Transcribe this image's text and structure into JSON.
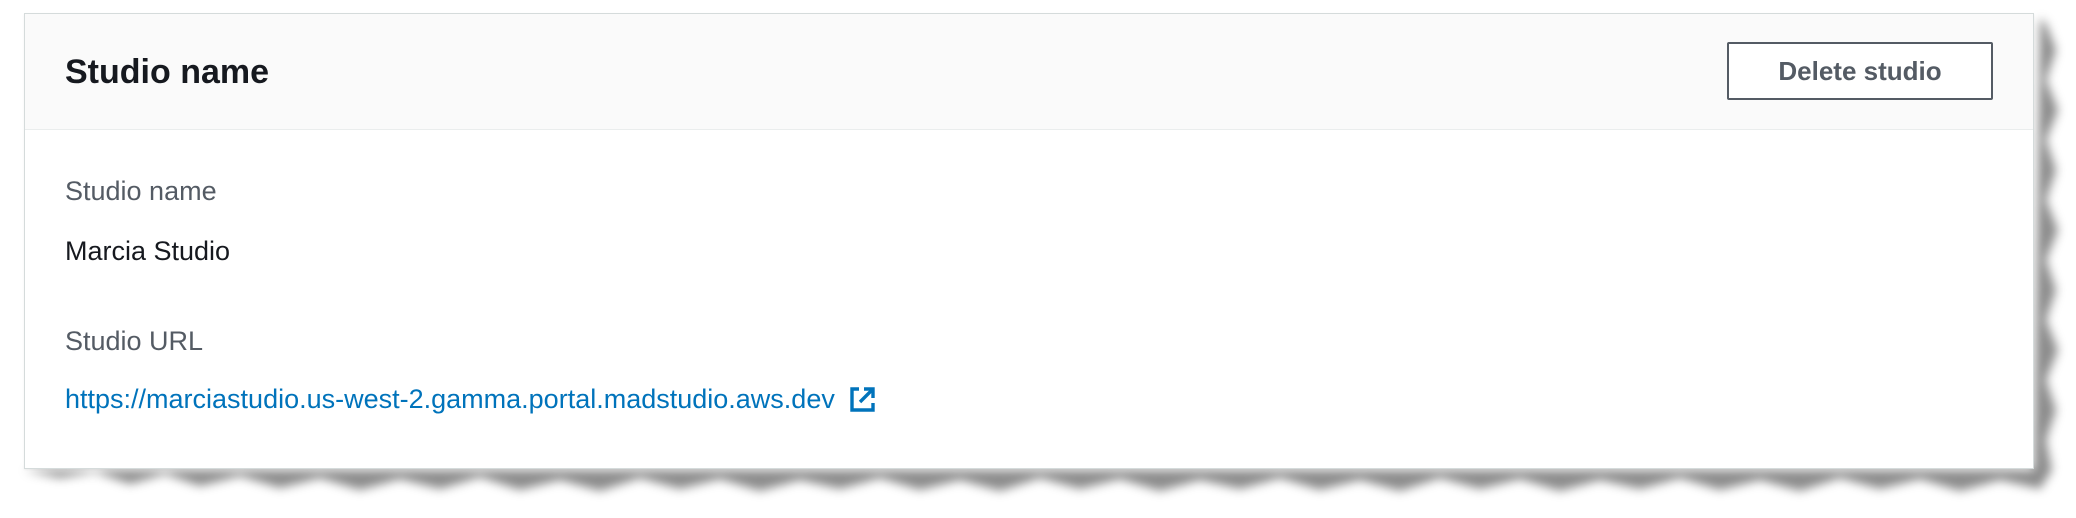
{
  "panel": {
    "title": "Studio name",
    "delete_button_label": "Delete studio"
  },
  "fields": {
    "studio_name_label": "Studio name",
    "studio_name_value": "Marcia Studio",
    "studio_url_label": "Studio URL",
    "studio_url_value": "https://marciastudio.us-west-2.gamma.portal.madstudio.aws.dev"
  },
  "icons": {
    "external_link": "external-link-icon"
  },
  "colors": {
    "link": "#0073bb",
    "title": "#16191f",
    "label": "#545b64",
    "button_border": "#545b64",
    "header_background": "#fafafa"
  }
}
